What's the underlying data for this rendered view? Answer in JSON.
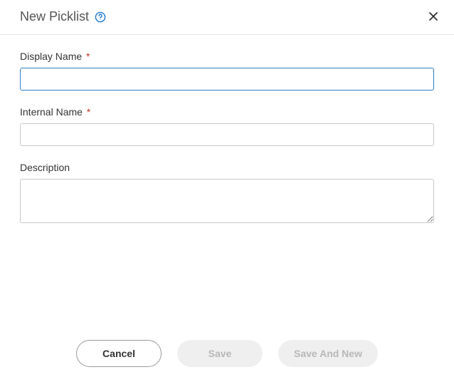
{
  "header": {
    "title": "New Picklist"
  },
  "form": {
    "displayName": {
      "label": "Display Name",
      "required": "*",
      "value": ""
    },
    "internalName": {
      "label": "Internal Name",
      "required": "*",
      "value": ""
    },
    "description": {
      "label": "Description",
      "value": ""
    }
  },
  "footer": {
    "cancel": "Cancel",
    "save": "Save",
    "saveAndNew": "Save And New"
  }
}
